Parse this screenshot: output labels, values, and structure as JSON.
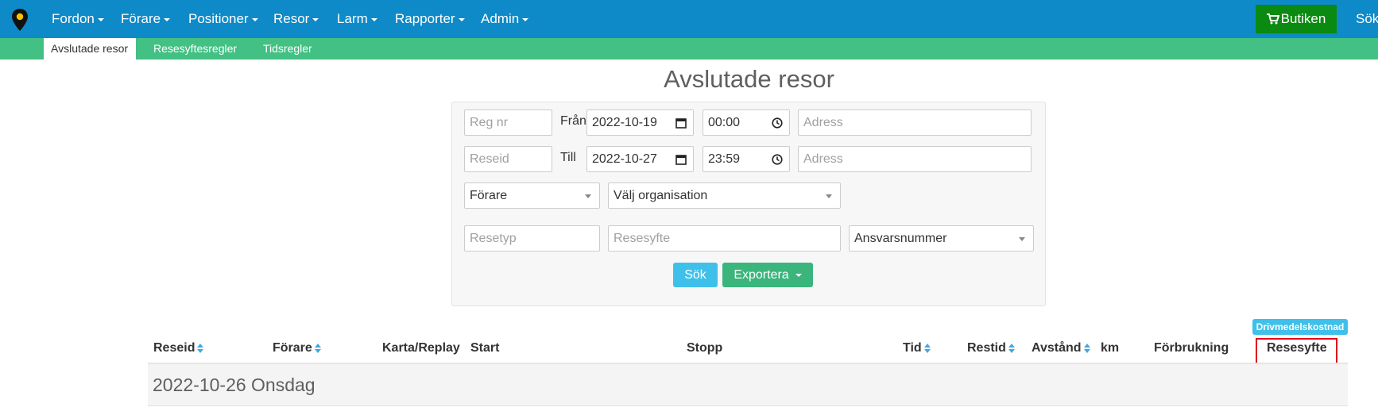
{
  "nav": {
    "logo_icon": "map-pin-icon",
    "items": [
      {
        "label": "Fordon"
      },
      {
        "label": "Förare"
      },
      {
        "label": "Positioner"
      },
      {
        "label": "Resor"
      },
      {
        "label": "Larm"
      },
      {
        "label": "Rapporter"
      },
      {
        "label": "Admin"
      }
    ],
    "shop_label": "Butiken",
    "shop_icon": "shopping-cart-icon",
    "search_label": "Sök",
    "colors": {
      "bar": "#0e8ac8",
      "shop": "#0a8a10"
    }
  },
  "subnav": {
    "items": [
      {
        "label": "Avslutade resor",
        "active": true
      },
      {
        "label": "Resesyftesregler"
      },
      {
        "label": "Tidsregler"
      }
    ],
    "color": "#43c083"
  },
  "page": {
    "title": "Avslutade resor"
  },
  "filters": {
    "reg_nr_placeholder": "Reg nr",
    "from_label": "Från",
    "from_date": "2022-10-19",
    "from_time": "00:00",
    "address_from_placeholder": "Adress",
    "reseid_placeholder": "Reseid",
    "to_label": "Till",
    "to_date": "2022-10-27",
    "to_time": "23:59",
    "address_to_placeholder": "Adress",
    "driver_select": "Förare",
    "org_select": "Välj organisation",
    "resetyp_placeholder": "Resetyp",
    "resesyfte_placeholder": "Resesyfte",
    "ansvar_select": "Ansvarsnummer",
    "search_button": "Sök",
    "export_button": "Exportera"
  },
  "table": {
    "columns": [
      {
        "label": "Reseid",
        "sortable": true
      },
      {
        "label": "Förare",
        "sortable": true
      },
      {
        "label": "Karta/Replay",
        "sortable": false
      },
      {
        "label": "Start",
        "sortable": false
      },
      {
        "label": "Stopp",
        "sortable": false
      },
      {
        "label": "Tid",
        "sortable": true
      },
      {
        "label": "Restid",
        "sortable": true
      },
      {
        "label": "Avstånd",
        "sortable": true
      },
      {
        "label": "km",
        "sortable": false
      },
      {
        "label": "Förbrukning",
        "sortable": false
      },
      {
        "label": "Resesyfte",
        "sortable": false
      }
    ],
    "badge": "Drivmedelskostnad",
    "highlight_color": "#e0001a",
    "groups": [
      {
        "label": "2022-10-26 Onsdag"
      }
    ]
  }
}
